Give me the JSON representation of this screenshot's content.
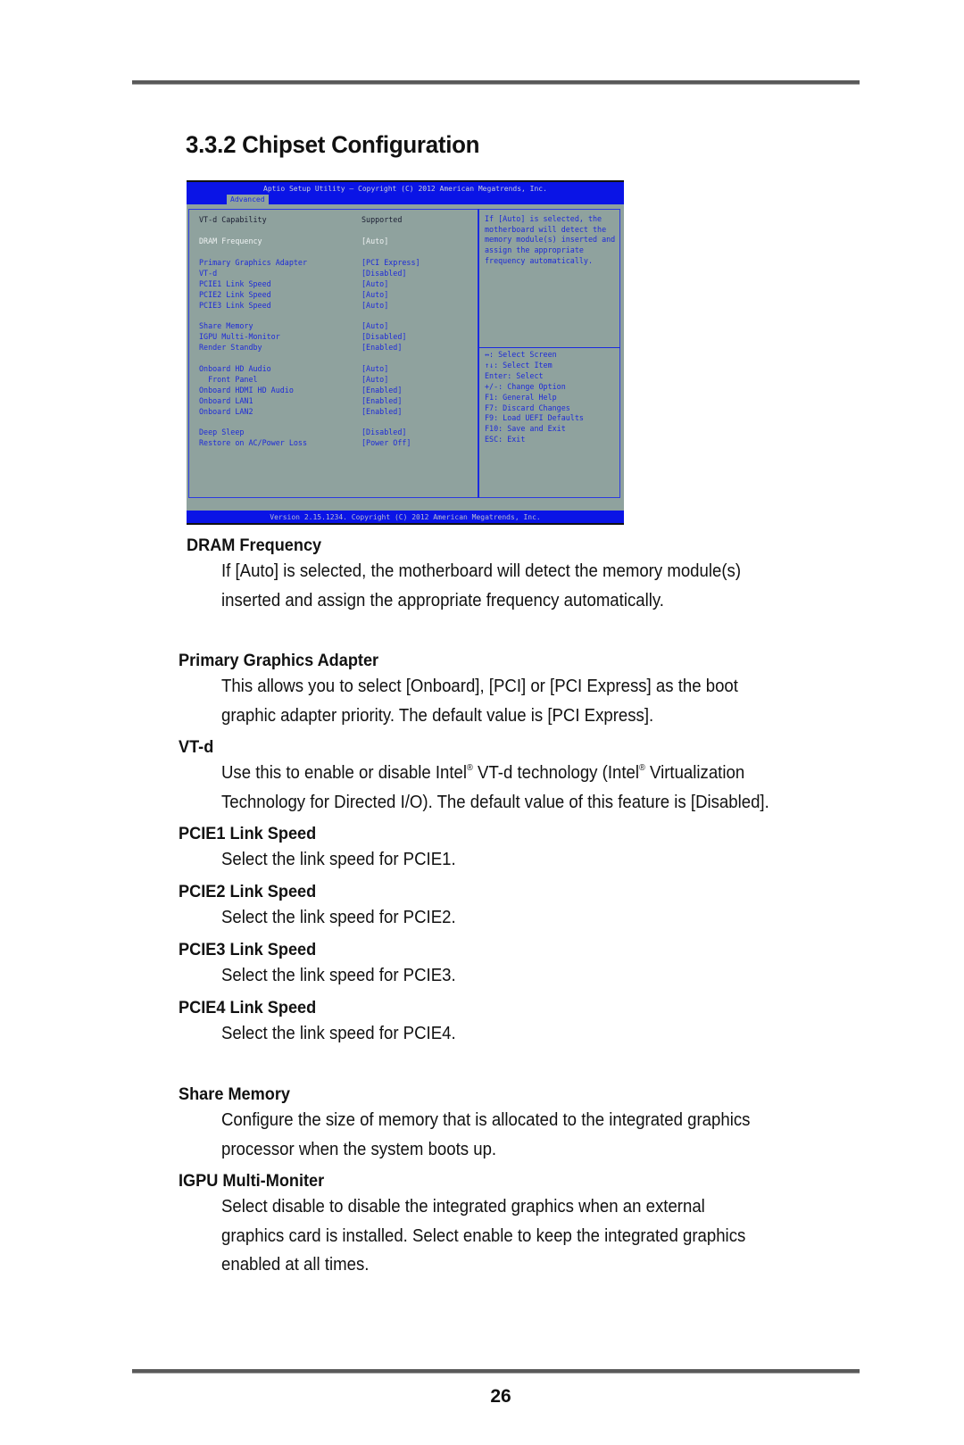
{
  "section_title": "3.3.2  Chipset Configuration",
  "bios": {
    "title_bar": "Aptio Setup Utility – Copyright (C) 2012 American Megatrends, Inc.",
    "active_tab": "Advanced",
    "items": [
      {
        "label": "VT-d Capability",
        "value": "Supported",
        "kind": "static"
      },
      {
        "label": "DRAM Frequency",
        "value": "[Auto]",
        "kind": "selected"
      },
      {
        "label": "Primary Graphics Adapter",
        "value": "[PCI Express]",
        "kind": "item"
      },
      {
        "label": "VT-d",
        "value": "[Disabled]",
        "kind": "item"
      },
      {
        "label": "PCIE1 Link Speed",
        "value": "[Auto]",
        "kind": "item"
      },
      {
        "label": "PCIE2 Link Speed",
        "value": "[Auto]",
        "kind": "item"
      },
      {
        "label": "PCIE3 Link Speed",
        "value": "[Auto]",
        "kind": "item"
      },
      {
        "label": "Share Memory",
        "value": "[Auto]",
        "kind": "item"
      },
      {
        "label": "IGPU Multi-Monitor",
        "value": "[Disabled]",
        "kind": "item"
      },
      {
        "label": "Render Standby",
        "value": "[Enabled]",
        "kind": "item"
      },
      {
        "label": "Onboard HD Audio",
        "value": "[Auto]",
        "kind": "item"
      },
      {
        "label": "  Front Panel",
        "value": "[Auto]",
        "kind": "item"
      },
      {
        "label": "Onboard HDMI HD Audio",
        "value": "[Enabled]",
        "kind": "item"
      },
      {
        "label": "Onboard LAN1",
        "value": "[Enabled]",
        "kind": "item"
      },
      {
        "label": "Onboard LAN2",
        "value": "[Enabled]",
        "kind": "item"
      },
      {
        "label": "Deep Sleep",
        "value": "[Disabled]",
        "kind": "item"
      },
      {
        "label": "Restore on AC/Power Loss",
        "value": "[Power Off]",
        "kind": "item"
      }
    ],
    "help_lines": [
      "If [Auto] is selected, the",
      "motherboard will detect the",
      "memory module(s) inserted and",
      "assign the appropriate",
      "frequency automatically."
    ],
    "key_help": [
      "↔: Select Screen",
      "↑↓: Select Item",
      "Enter: Select",
      "+/-: Change Option",
      "F1: General Help",
      "F7: Discard Changes",
      "F9: Load UEFI Defaults",
      "F10: Save and Exit",
      "ESC: Exit"
    ],
    "version_bar": "Version 2.15.1234. Copyright (C) 2012 American Megatrends, Inc."
  },
  "sections": [
    {
      "heading": "DRAM Frequency",
      "body": [
        "If [Auto] is selected, the motherboard will detect the memory module(s)",
        "inserted and assign the appropriate frequency automatically."
      ]
    },
    {
      "heading": "Primary Graphics Adapter",
      "body": [
        "This allows you to select [Onboard], [PCI] or [PCI Express] as the boot",
        "graphic adapter priority. The default value is [PCI Express]."
      ]
    },
    {
      "heading": "VT-d",
      "body_rich": {
        "part1": "Use this to enable or disable Intel",
        "reg": "®",
        "part2": " VT-d technology (Intel",
        "part3": " Virtualization",
        "line2": "Technology for Directed I/O). The default value of this feature is [Disabled]."
      }
    },
    {
      "heading": "PCIE1 Link Speed",
      "body": [
        "Select the link speed for PCIE1."
      ]
    },
    {
      "heading": "PCIE2 Link Speed",
      "body": [
        "Select the link speed for PCIE2."
      ]
    },
    {
      "heading": "PCIE3 Link Speed",
      "body": [
        "Select the link speed for PCIE3."
      ]
    },
    {
      "heading": "PCIE4 Link Speed",
      "body": [
        "Select the link speed for PCIE4."
      ]
    },
    {
      "heading": "Share Memory",
      "body": [
        "Configure the size of memory that is allocated to the integrated graphics",
        "processor when the system boots up."
      ]
    },
    {
      "heading": "IGPU Multi-Moniter",
      "body": [
        "Select disable to disable the integrated graphics when an external",
        "graphics card is installed. Select enable to keep the integrated graphics",
        "enabled at all times."
      ]
    }
  ],
  "page_number": "26"
}
